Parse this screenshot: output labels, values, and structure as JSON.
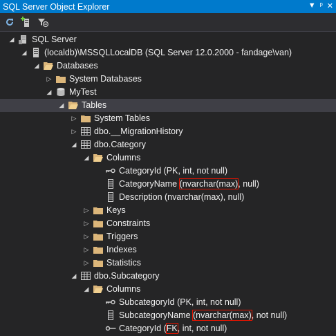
{
  "window": {
    "title": "SQL Server Object Explorer",
    "controls": [
      "▼",
      "ᵖ",
      "✕"
    ]
  },
  "toolbar": {
    "buttons": [
      "refresh-icon",
      "add-sql-server-icon",
      "stop-filter-icon"
    ]
  },
  "tree": [
    {
      "id": "sql-server",
      "segments": [
        {
          "text": "SQL Server"
        }
      ],
      "icon": "server-group-icon",
      "expander": "expanded"
    },
    {
      "id": "localdb",
      "segments": [
        {
          "text": "(localdb)\\MSSQLLocalDB (SQL Server 12.0.2000 - fandage\\van)"
        }
      ],
      "icon": "server-icon",
      "expander": "expanded"
    },
    {
      "id": "databases",
      "segments": [
        {
          "text": "Databases"
        }
      ],
      "icon": "open-folder-icon",
      "expander": "expanded"
    },
    {
      "id": "system-databases",
      "segments": [
        {
          "text": "System Databases"
        }
      ],
      "icon": "folder-icon",
      "expander": "collapsed"
    },
    {
      "id": "mytest",
      "segments": [
        {
          "text": "MyTest"
        }
      ],
      "icon": "database-icon",
      "expander": "expanded"
    },
    {
      "id": "tables",
      "segments": [
        {
          "text": "Tables"
        }
      ],
      "icon": "open-folder-icon",
      "expander": "expanded",
      "selected": true
    },
    {
      "id": "system-tables",
      "segments": [
        {
          "text": "System Tables"
        }
      ],
      "icon": "folder-icon",
      "expander": "collapsed"
    },
    {
      "id": "migration-history",
      "segments": [
        {
          "text": "dbo.__MigrationHistory"
        }
      ],
      "icon": "table-icon",
      "expander": "collapsed"
    },
    {
      "id": "dbo-category",
      "segments": [
        {
          "text": "dbo.Category"
        }
      ],
      "icon": "table-icon",
      "expander": "expanded"
    },
    {
      "id": "category-columns",
      "segments": [
        {
          "text": "Columns"
        }
      ],
      "icon": "open-folder-icon",
      "expander": "expanded"
    },
    {
      "id": "col-categoryid",
      "segments": [
        {
          "text": "CategoryId (PK, int, not null)"
        }
      ],
      "icon": "primary-key-icon",
      "expander": "none"
    },
    {
      "id": "col-categoryname",
      "segments": [
        {
          "text": "CategoryName "
        },
        {
          "text": "(nvarchar(max)",
          "highlight": true
        },
        {
          "text": ", null)"
        }
      ],
      "icon": "column-icon",
      "expander": "none"
    },
    {
      "id": "col-description",
      "segments": [
        {
          "text": "Description (nvarchar(max), null)"
        }
      ],
      "icon": "column-icon",
      "expander": "none"
    },
    {
      "id": "keys",
      "segments": [
        {
          "text": "Keys"
        }
      ],
      "icon": "folder-icon",
      "expander": "collapsed"
    },
    {
      "id": "constraints",
      "segments": [
        {
          "text": "Constraints"
        }
      ],
      "icon": "folder-icon",
      "expander": "collapsed"
    },
    {
      "id": "triggers",
      "segments": [
        {
          "text": "Triggers"
        }
      ],
      "icon": "folder-icon",
      "expander": "collapsed"
    },
    {
      "id": "indexes",
      "segments": [
        {
          "text": "Indexes"
        }
      ],
      "icon": "folder-icon",
      "expander": "collapsed"
    },
    {
      "id": "statistics",
      "segments": [
        {
          "text": "Statistics"
        }
      ],
      "icon": "folder-icon",
      "expander": "collapsed"
    },
    {
      "id": "dbo-subcategory",
      "segments": [
        {
          "text": "dbo.Subcategory"
        }
      ],
      "icon": "table-icon",
      "expander": "expanded"
    },
    {
      "id": "subcategory-columns",
      "segments": [
        {
          "text": "Columns"
        }
      ],
      "icon": "open-folder-icon",
      "expander": "expanded"
    },
    {
      "id": "col-subcategoryid",
      "segments": [
        {
          "text": "SubcategoryId (PK, int, not null)"
        }
      ],
      "icon": "primary-key-icon",
      "expander": "none"
    },
    {
      "id": "col-subcategoryname",
      "segments": [
        {
          "text": "SubcategoryName "
        },
        {
          "text": "(nvarchar(max)",
          "highlight": true
        },
        {
          "text": ", not null)"
        }
      ],
      "icon": "column-icon",
      "expander": "none"
    },
    {
      "id": "col-sub-categoryid",
      "segments": [
        {
          "text": "CategoryId ("
        },
        {
          "text": "FK",
          "highlight": true
        },
        {
          "text": ", int, not null)"
        }
      ],
      "icon": "foreign-key-icon",
      "expander": "none"
    }
  ],
  "colors": {
    "title_bar": "#007acc",
    "background": "#252526",
    "selection": "#3f3f46",
    "highlight_box": "#e51400",
    "folder": "#dcb67a"
  }
}
